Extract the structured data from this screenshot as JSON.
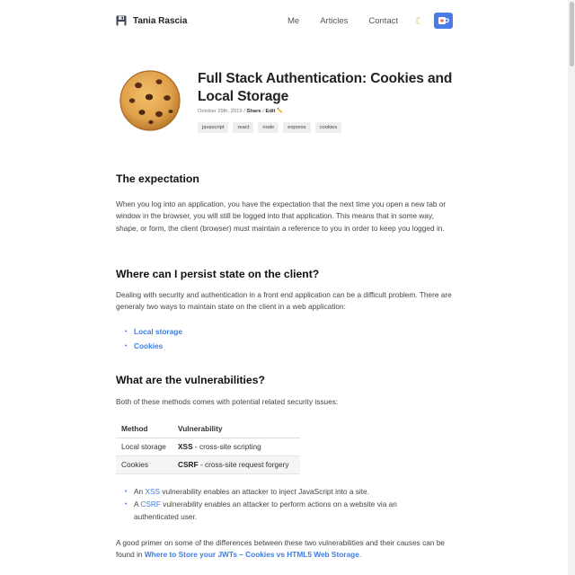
{
  "nav": {
    "brand": "Tania Rascia",
    "links": [
      "Me",
      "Articles",
      "Contact"
    ],
    "theme_icon": "moon-icon",
    "support_icon": "ko-fi-cup-icon"
  },
  "post": {
    "title": "Full Stack Authentication: Cookies and Local Storage",
    "date": "October 29th, 2019",
    "share_label": "Share",
    "edit_label": "Edit ✏️",
    "tags": [
      "javascript",
      "react",
      "node",
      "express",
      "cookies"
    ]
  },
  "sections": {
    "expectation": {
      "heading": "The expectation",
      "body": "When you log into an application, you have the expectation that the next time you open a new tab or window in the browser, you will still be logged into that application. This means that in some way, shape, or form, the client (browser) must maintain a reference to you in order to keep you logged in."
    },
    "persist": {
      "heading": "Where can I persist state on the client?",
      "body": "Dealing with security and authentication in a front end application can be a difficult problem. There are generaly two ways to maintain state on the client in a web application:",
      "links": [
        "Local storage",
        "Cookies"
      ]
    },
    "vulnerabilities": {
      "heading": "What are the vulnerabilities?",
      "body": "Both of these methods comes with potential related security issues:",
      "table": {
        "headers": [
          "Method",
          "Vulnerability"
        ],
        "rows": [
          {
            "method": "Local storage",
            "abbr": "XSS",
            "desc": " - cross-site scripting"
          },
          {
            "method": "Cookies",
            "abbr": "CSRF",
            "desc": " - cross-site request forgery"
          }
        ]
      },
      "notes": [
        {
          "pre": "An ",
          "link": "XSS",
          "post": " vulnerability enables an attacker to inject JavaScript into a site."
        },
        {
          "pre": "A ",
          "link": "CSRF",
          "post": " vulnerability enables an attacker to perform actions on a website via an authenticated user."
        }
      ],
      "primer_pre": "A good primer on some of the differences between these two vulnerabilities and their causes can be found in ",
      "primer_link": "Where to Store your JWTs – Cookies vs HTML5 Web Storage",
      "primer_post": "."
    }
  },
  "colors": {
    "accent": "#3d7de3",
    "ko_fi_button": "#4b7be5",
    "table_shade": "#f5f5f5"
  }
}
